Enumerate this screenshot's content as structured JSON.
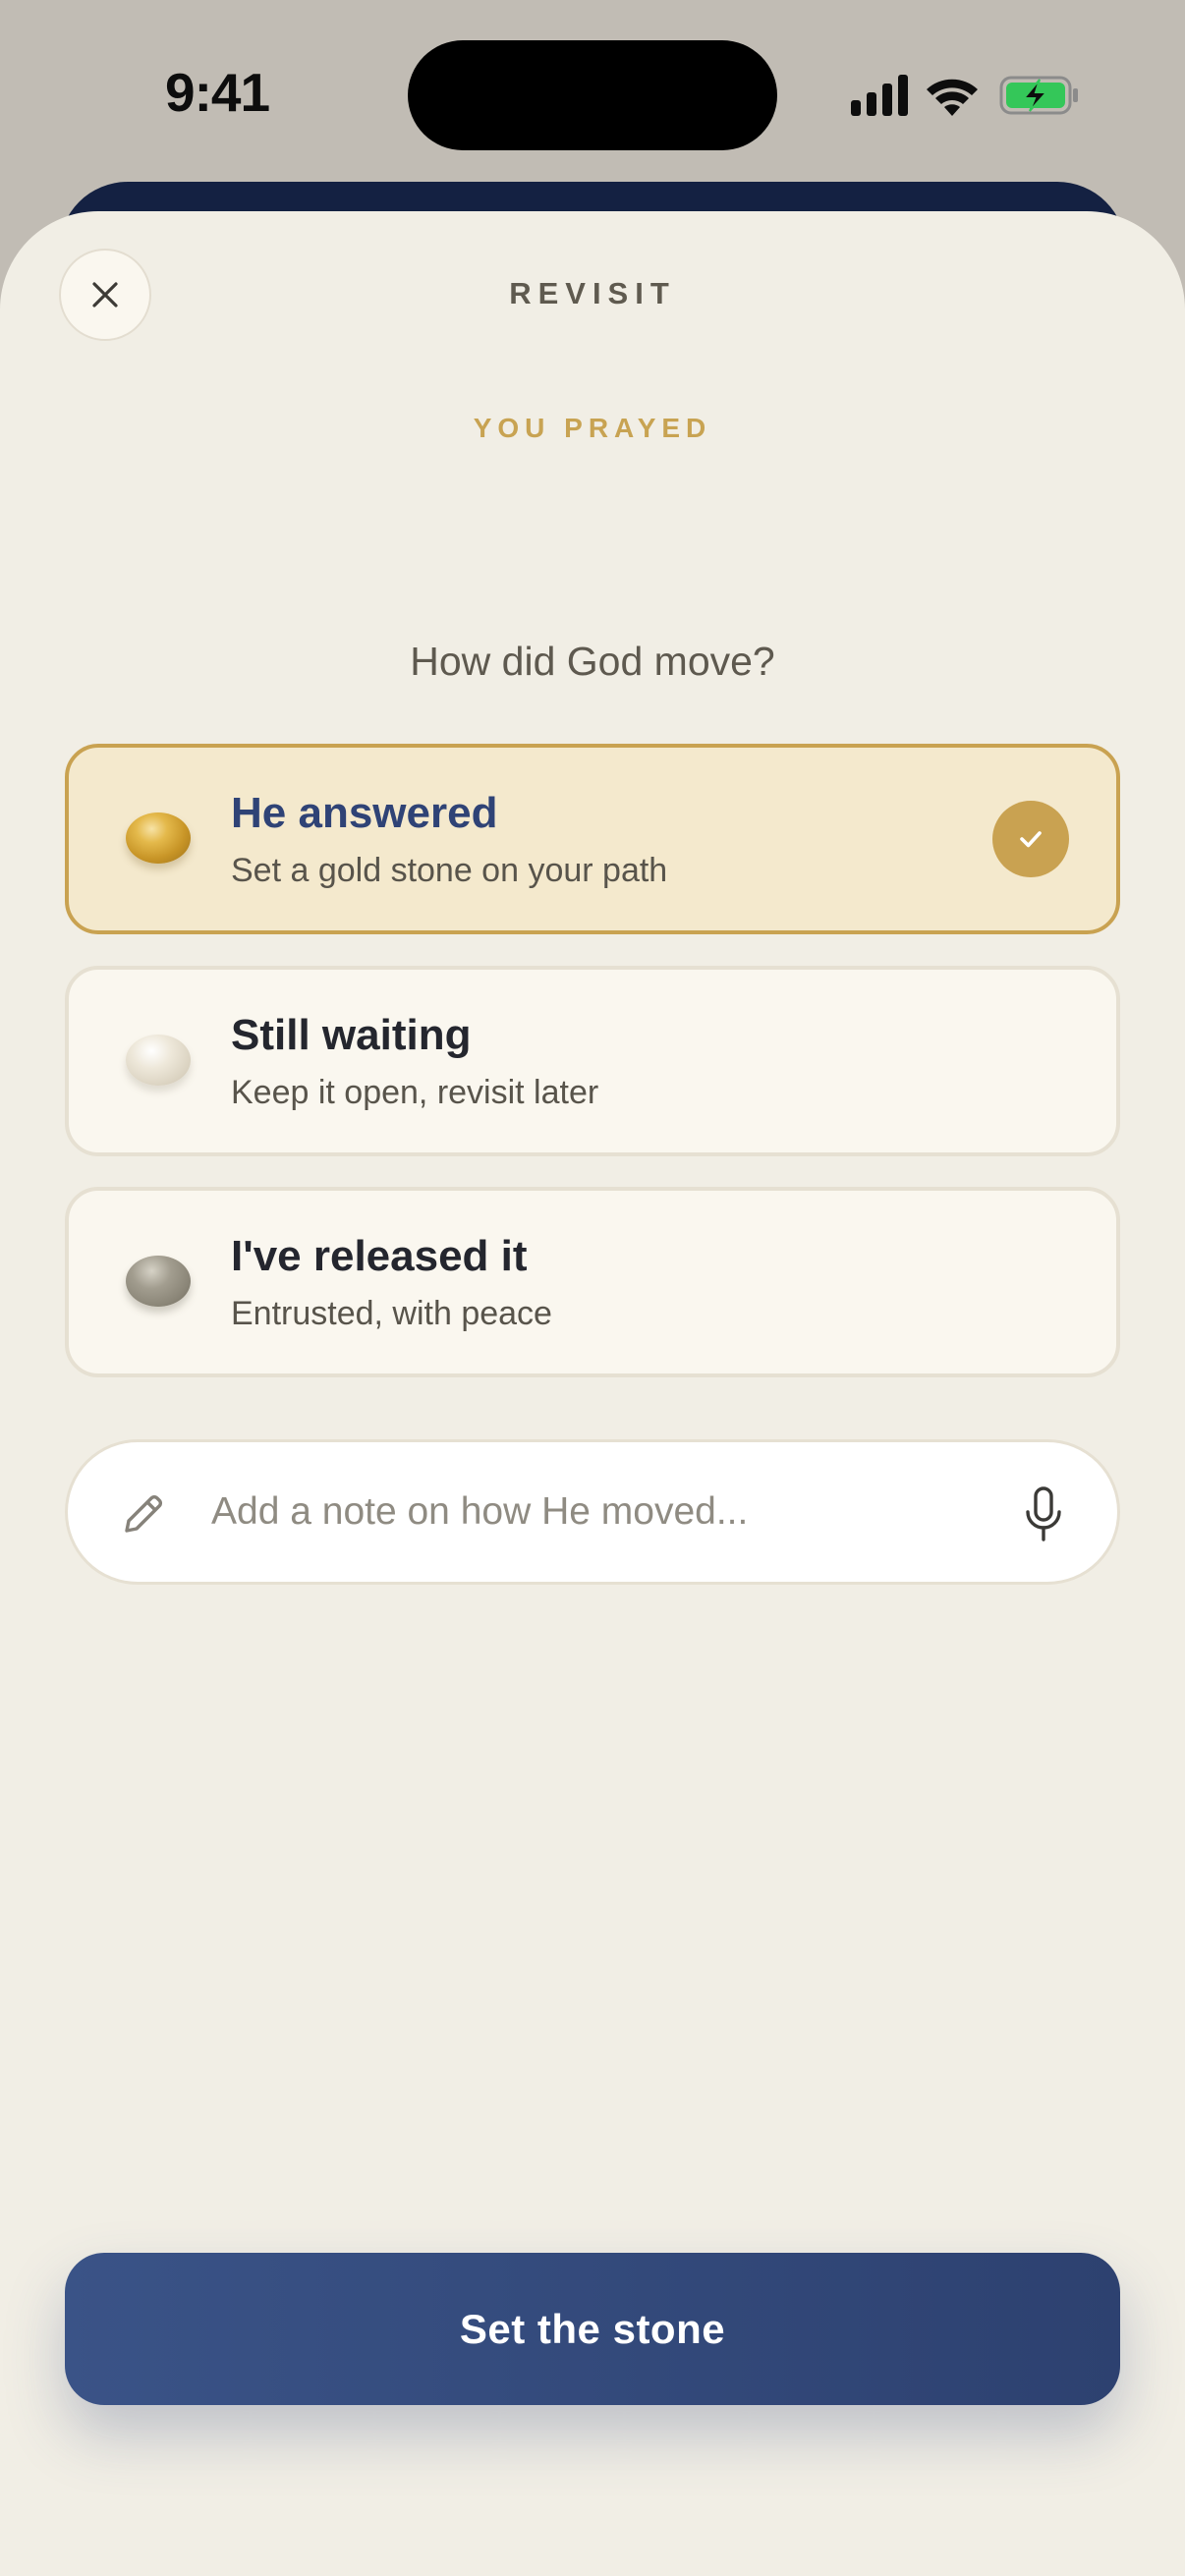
{
  "status_bar": {
    "time": "9:41"
  },
  "header": {
    "title": "REVISIT",
    "close_icon": "close-icon"
  },
  "eyebrow": "YOU PRAYED",
  "question": "How did God move?",
  "options": [
    {
      "title": "He answered",
      "subtitle": "Set a gold stone on your path",
      "stone": "gold",
      "selected": true
    },
    {
      "title": "Still waiting",
      "subtitle": "Keep it open, revisit later",
      "stone": "pale",
      "selected": false
    },
    {
      "title": "I've released it",
      "subtitle": "Entrusted, with peace",
      "stone": "grey",
      "selected": false
    }
  ],
  "note": {
    "placeholder": "Add a note on how He moved...",
    "value": "",
    "leading_icon": "pencil-icon",
    "trailing_icon": "microphone-icon"
  },
  "primary_button": {
    "label": "Set the stone"
  },
  "colors": {
    "accent_gold": "#c9a251",
    "primary_blue": "#2f4376",
    "sheet_background": "#f1eee5",
    "selected_background": "#f4e9cd",
    "battery_green": "#34c759"
  }
}
